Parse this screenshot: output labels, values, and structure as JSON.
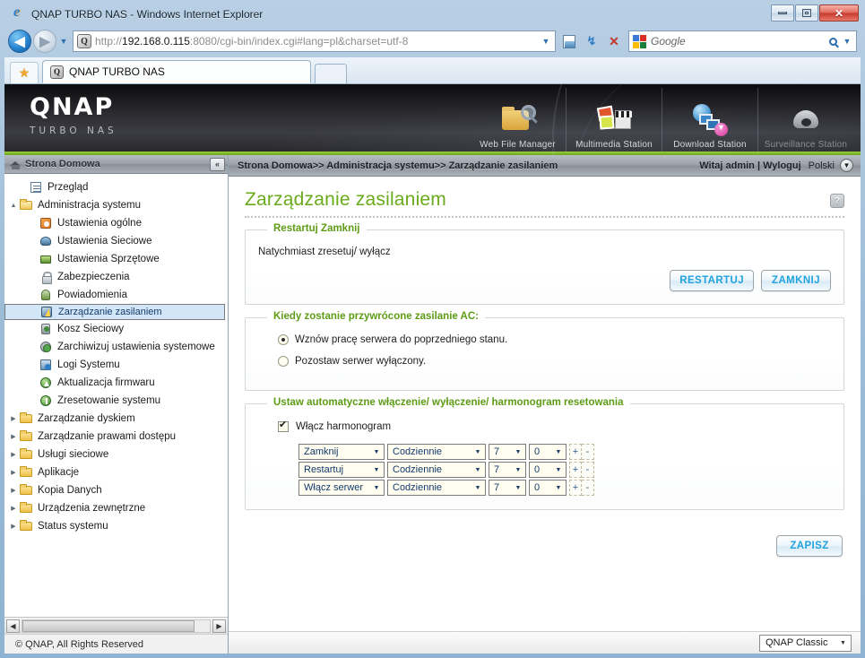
{
  "window": {
    "title": "QNAP TURBO NAS - Windows Internet Explorer",
    "minimize_label": "Minimize",
    "maximize_label": "Maximize",
    "close_label": "✕"
  },
  "browser": {
    "back_label": "◀",
    "forward_label": "▶",
    "history_caret": "▼",
    "url_protocol": "http://",
    "url_host": "192.168.0.115",
    "url_rest": ":8080/cgi-bin/index.cgi#lang=pl&charset=utf-8",
    "url_full": "http://192.168.0.115:8080/cgi-bin/index.cgi#lang=pl&charset=utf-8",
    "address_caret": "▼",
    "compat_label": "Compatibility View",
    "refresh_label": "↯",
    "stop_label": "✕",
    "search_placeholder": "Google",
    "search_caret": "▼",
    "favorites_label": "★",
    "tab_label": "QNAP TURBO NAS",
    "tab_icon_letter": "Q",
    "address_icon_letter": "Q"
  },
  "banner": {
    "logo": "QNAP",
    "logo_sub": "TURBO NAS",
    "stations": [
      {
        "name": "Web File Manager",
        "icon": "web-file-manager-icon",
        "dim": false
      },
      {
        "name": "Multimedia Station",
        "icon": "multimedia-station-icon",
        "dim": false
      },
      {
        "name": "Download Station",
        "icon": "download-station-icon",
        "dim": false
      },
      {
        "name": "Surveillance Station",
        "icon": "surveillance-station-icon",
        "dim": true
      }
    ]
  },
  "sidebar": {
    "header_title": "Strona Domowa",
    "collapse_label": "«",
    "items": [
      {
        "label": "Przegląd",
        "icon": "overview-icon",
        "indent": 1,
        "arrow": "",
        "selected": false
      },
      {
        "label": "Administracja systemu",
        "icon": "folder-open-icon",
        "indent": 0,
        "arrow": "▲",
        "selected": false
      },
      {
        "label": "Ustawienia ogólne",
        "icon": "general-settings-icon",
        "indent": 2,
        "arrow": "",
        "selected": false
      },
      {
        "label": "Ustawienia Sieciowe",
        "icon": "network-settings-icon",
        "indent": 2,
        "arrow": "",
        "selected": false
      },
      {
        "label": "Ustawienia Sprzętowe",
        "icon": "hardware-settings-icon",
        "indent": 2,
        "arrow": "",
        "selected": false
      },
      {
        "label": "Zabezpieczenia",
        "icon": "security-lock-icon",
        "indent": 2,
        "arrow": "",
        "selected": false
      },
      {
        "label": "Powiadomienia",
        "icon": "notification-bell-icon",
        "indent": 2,
        "arrow": "",
        "selected": false
      },
      {
        "label": "Zarządzanie zasilaniem",
        "icon": "power-management-icon",
        "indent": 2,
        "arrow": "",
        "selected": true
      },
      {
        "label": "Kosz Sieciowy",
        "icon": "network-recycle-bin-icon",
        "indent": 2,
        "arrow": "",
        "selected": false
      },
      {
        "label": "Zarchiwizuj ustawienia systemowe",
        "icon": "backup-settings-icon",
        "indent": 2,
        "arrow": "",
        "selected": false
      },
      {
        "label": "Logi Systemu",
        "icon": "system-logs-icon",
        "indent": 2,
        "arrow": "",
        "selected": false
      },
      {
        "label": "Aktualizacja firmwaru",
        "icon": "firmware-update-icon",
        "indent": 2,
        "arrow": "",
        "selected": false
      },
      {
        "label": "Zresetowanie systemu",
        "icon": "system-reset-icon",
        "indent": 2,
        "arrow": "",
        "selected": false
      },
      {
        "label": "Zarządzanie dyskiem",
        "icon": "folder-icon",
        "indent": 0,
        "arrow": "▶",
        "selected": false
      },
      {
        "label": "Zarządzanie prawami dostępu",
        "icon": "folder-icon",
        "indent": 0,
        "arrow": "▶",
        "selected": false
      },
      {
        "label": "Usługi sieciowe",
        "icon": "folder-icon",
        "indent": 0,
        "arrow": "▶",
        "selected": false
      },
      {
        "label": "Aplikacje",
        "icon": "folder-icon",
        "indent": 0,
        "arrow": "▶",
        "selected": false
      },
      {
        "label": "Kopia Danych",
        "icon": "folder-icon",
        "indent": 0,
        "arrow": "▶",
        "selected": false
      },
      {
        "label": "Urządzenia zewnętrzne",
        "icon": "folder-icon",
        "indent": 0,
        "arrow": "▶",
        "selected": false
      },
      {
        "label": "Status systemu",
        "icon": "folder-icon",
        "indent": 0,
        "arrow": "▶",
        "selected": false
      }
    ],
    "scroll_left": "◀",
    "scroll_right": "▶",
    "copyright": "© QNAP, All Rights Reserved"
  },
  "breadcrumb": {
    "text": "Strona Domowa>> Administracja systemu>> Zarządzanie zasilaniem",
    "welcome": "Witaj admin | Wyloguj",
    "language": "Polski",
    "language_caret": "▼"
  },
  "page": {
    "title": "Zarządzanie zasilaniem",
    "help_label": "?"
  },
  "restart_section": {
    "legend": "Restartuj Zamknij",
    "description": "Natychmiast zresetuj/ wyłącz",
    "restart_button": "RESTARTUJ",
    "shutdown_button": "ZAMKNIJ"
  },
  "ac_section": {
    "legend": "Kiedy zostanie przywrócone zasilanie AC:",
    "options": [
      {
        "label": "Wznów pracę serwera do poprzedniego stanu.",
        "selected": true
      },
      {
        "label": "Pozostaw serwer wyłączony.",
        "selected": false
      }
    ]
  },
  "schedule_section": {
    "legend": "Ustaw automatyczne włączenie/ wyłączenie/ harmonogram resetowania",
    "enable_label": "Włącz harmonogram",
    "enable_checked": true,
    "add_label": "+",
    "remove_label": "-",
    "rows": [
      {
        "action": "Zamknij",
        "frequency": "Codziennie",
        "hour": "7",
        "minute": "0"
      },
      {
        "action": "Restartuj",
        "frequency": "Codziennie",
        "hour": "7",
        "minute": "0"
      },
      {
        "action": "Włącz serwer",
        "frequency": "Codziennie",
        "hour": "7",
        "minute": "0"
      }
    ],
    "caret": "▼"
  },
  "footer": {
    "save_button": "ZAPISZ",
    "skin": "QNAP Classic",
    "skin_caret": "▼"
  },
  "colors": {
    "accent_green": "#6aab1d",
    "legend_green": "#5e9c16",
    "button_blue": "#21a2e0",
    "selected_row": "#d2e6f7"
  }
}
